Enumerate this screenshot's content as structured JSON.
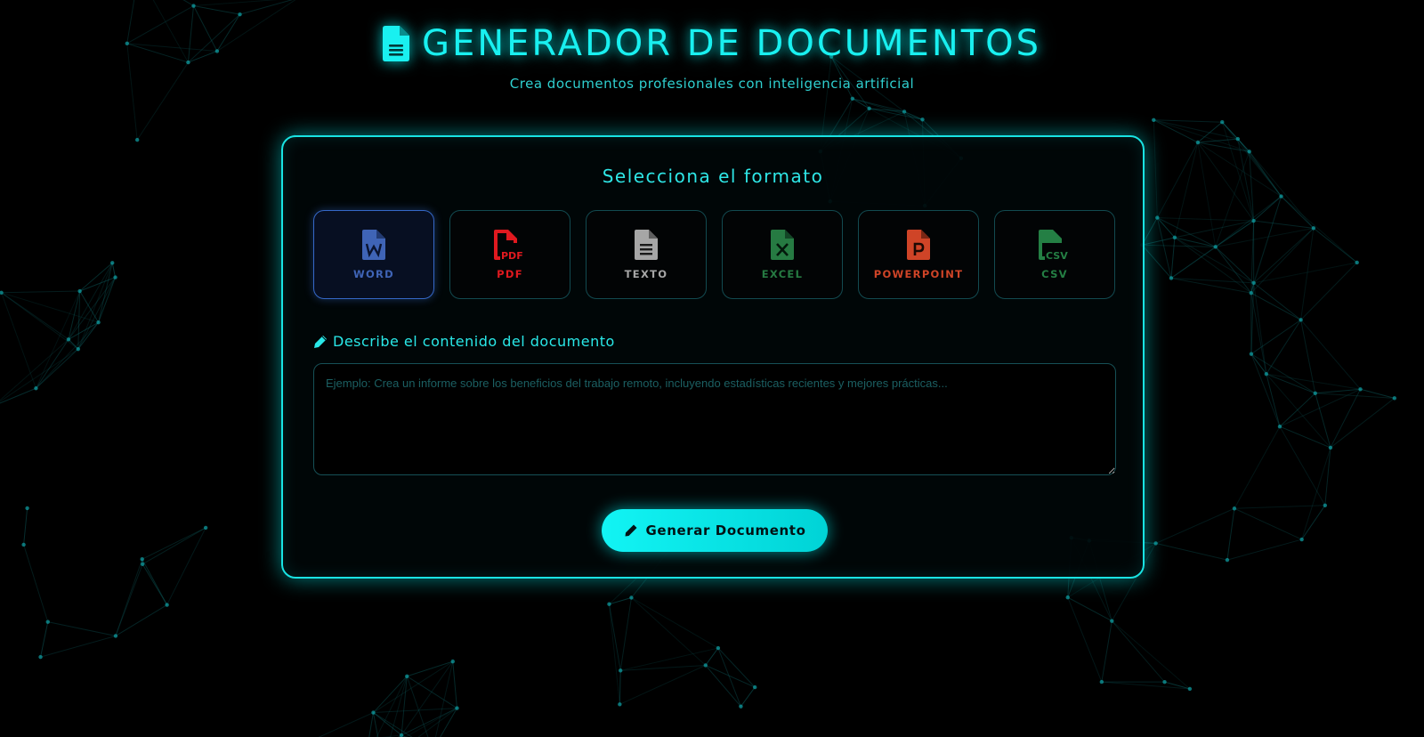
{
  "header": {
    "title": "GENERADOR DE DOCUMENTOS",
    "subtitle": "Crea documentos profesionales con inteligencia artificial",
    "icon": "file-text-icon"
  },
  "format_section": {
    "title": "Selecciona el formato",
    "selected": "WORD",
    "formats": [
      {
        "label": "WORD",
        "icon": "file-word-icon",
        "color": "#3f64b6"
      },
      {
        "label": "PDF",
        "icon": "file-pdf-icon",
        "color": "#e0191f"
      },
      {
        "label": "TEXTO",
        "icon": "file-text-icon",
        "color": "#a6a6a6"
      },
      {
        "label": "EXCEL",
        "icon": "file-excel-icon",
        "color": "#267a42"
      },
      {
        "label": "POWERPOINT",
        "icon": "file-powerpoint-icon",
        "color": "#cf4427"
      },
      {
        "label": "CSV",
        "icon": "file-csv-icon",
        "color": "#247f44"
      }
    ]
  },
  "description": {
    "label": "Describe el contenido del documento",
    "placeholder": "Ejemplo: Crea un informe sobre los beneficios del trabajo remoto, incluyendo estadísticas recientes y mejores prácticas...",
    "value": ""
  },
  "generate_button": {
    "label": "Generar Documento",
    "icon": "pencil-icon"
  },
  "theme": {
    "accent": "#19f0f0",
    "background": "#000000"
  }
}
